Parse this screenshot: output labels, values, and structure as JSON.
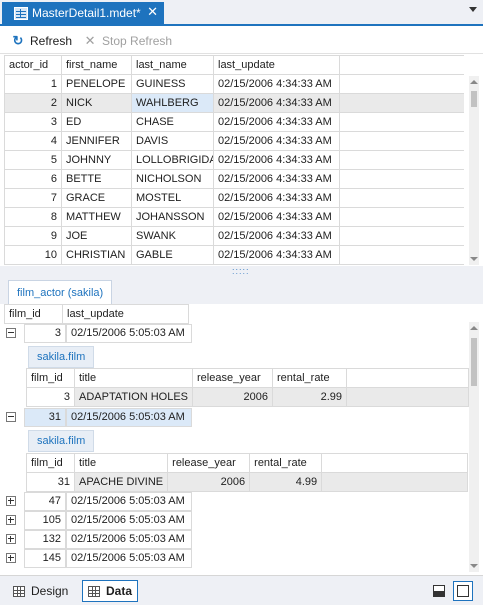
{
  "tab": {
    "title": "MasterDetail1.mdet*",
    "close_glyph": "✕"
  },
  "toolbar": {
    "refresh_label": "Refresh",
    "stop_refresh_label": "Stop Refresh"
  },
  "master": {
    "columns": [
      "actor_id",
      "first_name",
      "last_name",
      "last_update"
    ],
    "rows": [
      [
        "1",
        "PENELOPE",
        "GUINESS",
        "02/15/2006 4:34:33 AM"
      ],
      [
        "2",
        "NICK",
        "WAHLBERG",
        "02/15/2006 4:34:33 AM"
      ],
      [
        "3",
        "ED",
        "CHASE",
        "02/15/2006 4:34:33 AM"
      ],
      [
        "4",
        "JENNIFER",
        "DAVIS",
        "02/15/2006 4:34:33 AM"
      ],
      [
        "5",
        "JOHNNY",
        "LOLLOBRIGIDA",
        "02/15/2006 4:34:33 AM"
      ],
      [
        "6",
        "BETTE",
        "NICHOLSON",
        "02/15/2006 4:34:33 AM"
      ],
      [
        "7",
        "GRACE",
        "MOSTEL",
        "02/15/2006 4:34:33 AM"
      ],
      [
        "8",
        "MATTHEW",
        "JOHANSSON",
        "02/15/2006 4:34:33 AM"
      ],
      [
        "9",
        "JOE",
        "SWANK",
        "02/15/2006 4:34:33 AM"
      ],
      [
        "10",
        "CHRISTIAN",
        "GABLE",
        "02/15/2006 4:34:33 AM"
      ]
    ]
  },
  "detail": {
    "tab_label": "film_actor (sakila)",
    "columns": [
      "film_id",
      "last_update"
    ],
    "expanded": [
      {
        "film_id": "3",
        "last_update": "02/15/2006 5:05:03 AM",
        "sub_label": "sakila.film",
        "sub_columns": [
          "film_id",
          "title",
          "release_year",
          "rental_rate"
        ],
        "sub_row": [
          "3",
          "ADAPTATION HOLES",
          "2006",
          "2.99"
        ]
      },
      {
        "film_id": "31",
        "last_update": "02/15/2006 5:05:03 AM",
        "sub_label": "sakila.film",
        "sub_columns": [
          "film_id",
          "title",
          "release_year",
          "rental_rate"
        ],
        "sub_row": [
          "31",
          "APACHE DIVINE",
          "2006",
          "4.99"
        ]
      }
    ],
    "collapsed": [
      {
        "film_id": "47",
        "last_update": "02/15/2006 5:05:03 AM"
      },
      {
        "film_id": "105",
        "last_update": "02/15/2006 5:05:03 AM"
      },
      {
        "film_id": "132",
        "last_update": "02/15/2006 5:05:03 AM"
      },
      {
        "film_id": "145",
        "last_update": "02/15/2006 5:05:03 AM"
      }
    ]
  },
  "statusbar": {
    "design_label": "Design",
    "data_label": "Data"
  },
  "colors": {
    "accent": "#1e73be",
    "selection": "#dbe9f8",
    "chrome": "#eef0f5"
  }
}
